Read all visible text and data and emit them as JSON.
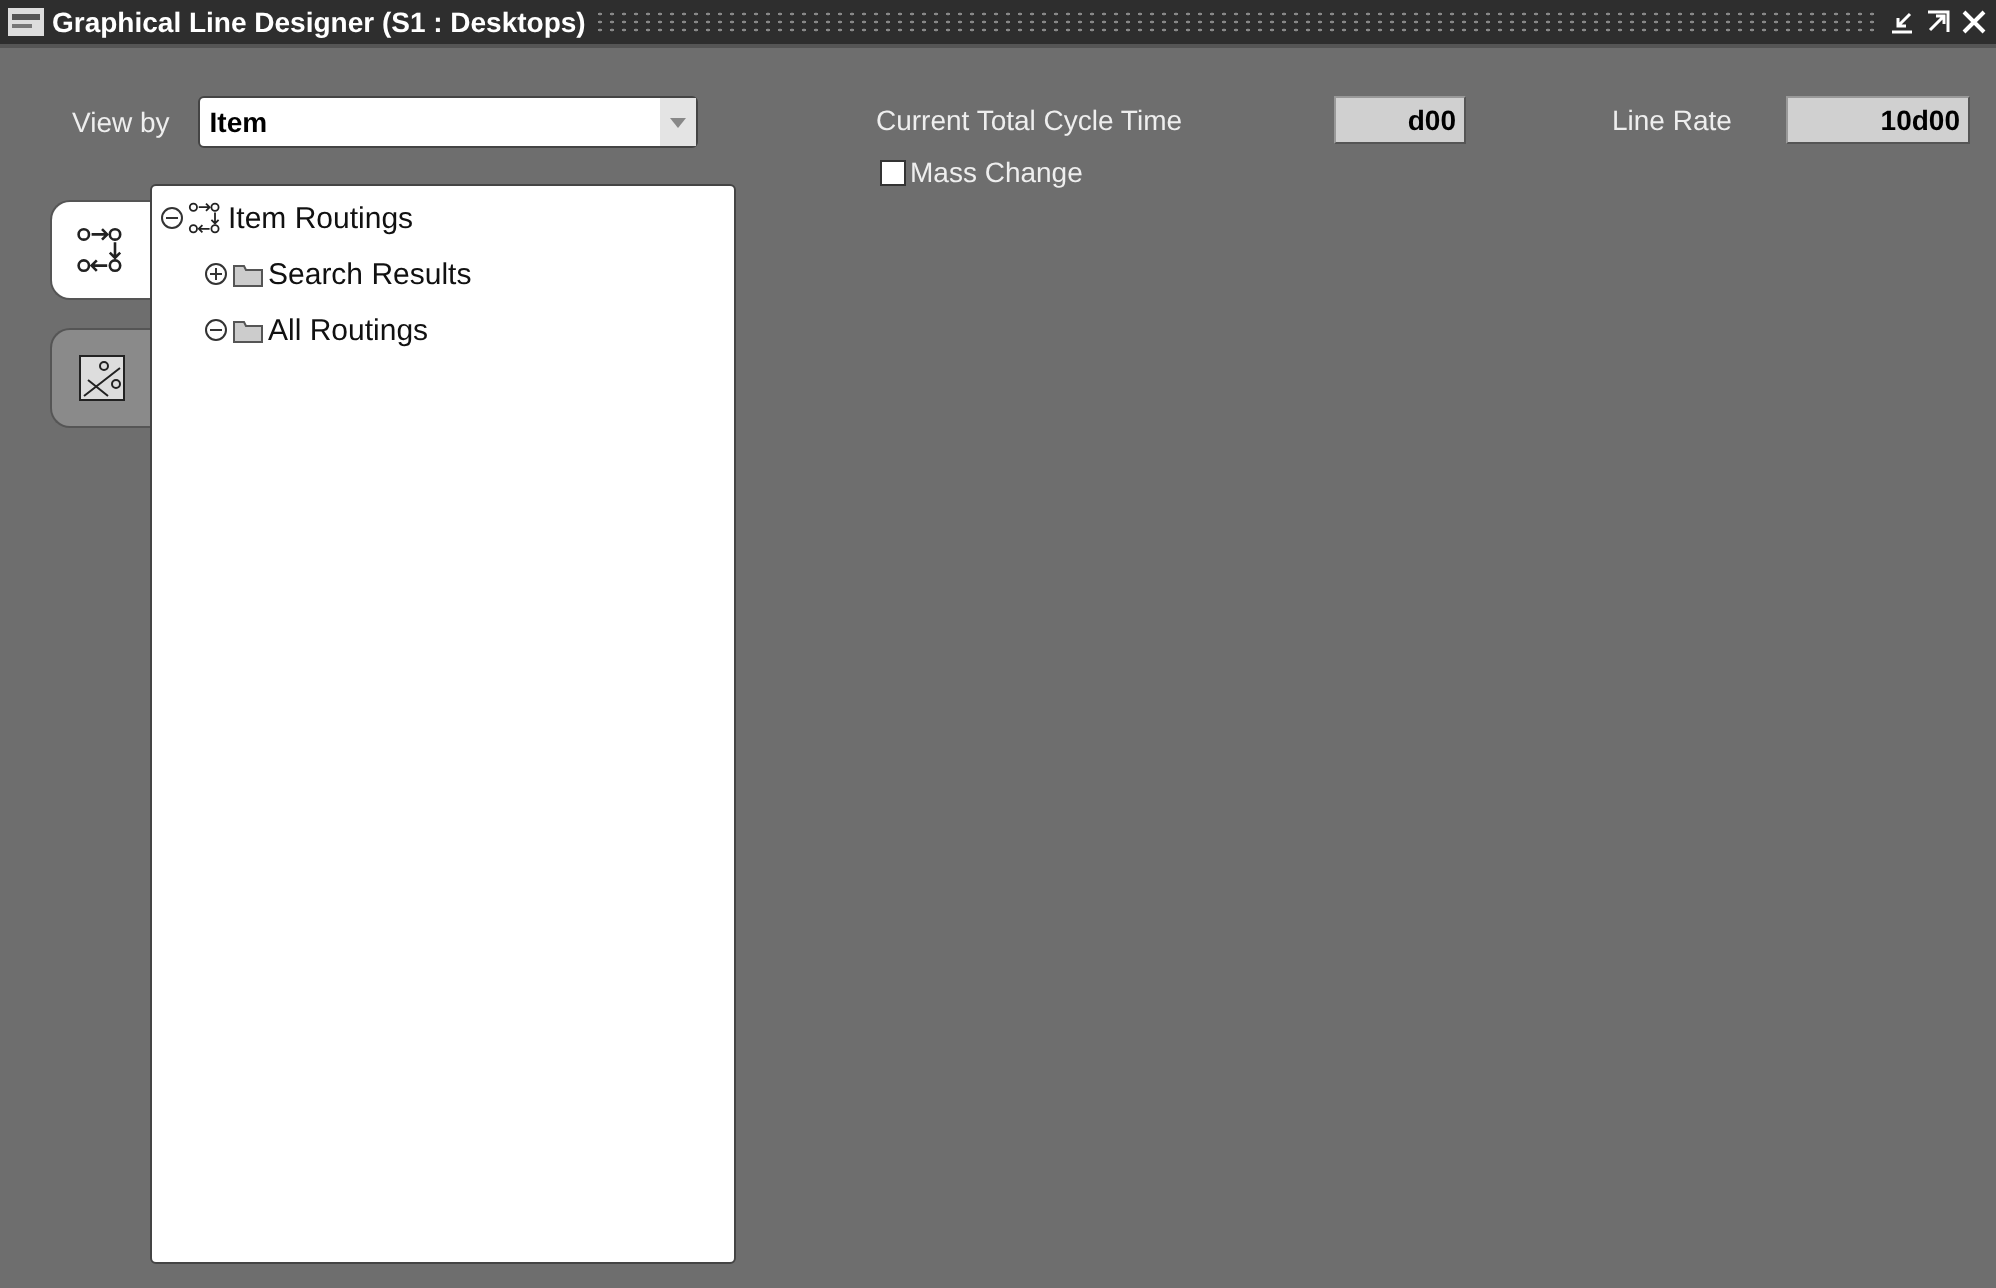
{
  "window": {
    "title": "Graphical Line Designer (S1 : Desktops)"
  },
  "view_by": {
    "label": "View by",
    "value": "Item"
  },
  "side_tabs": [
    {
      "kind": "routing",
      "selected": true
    },
    {
      "kind": "diagram",
      "selected": false
    }
  ],
  "tree": [
    {
      "label": "Item Routings",
      "kind": "routing",
      "expanded": true,
      "children": [
        {
          "label": "Search Results",
          "kind": "folder",
          "expanded": false
        },
        {
          "label": "All Routings",
          "kind": "folder",
          "expanded": true
        }
      ]
    }
  ],
  "cycle_time": {
    "label": "Current Total Cycle Time",
    "value": "d00"
  },
  "line_rate": {
    "label": "Line Rate",
    "value": "10d00"
  },
  "mass_change": {
    "label": "Mass Change",
    "checked": false
  }
}
